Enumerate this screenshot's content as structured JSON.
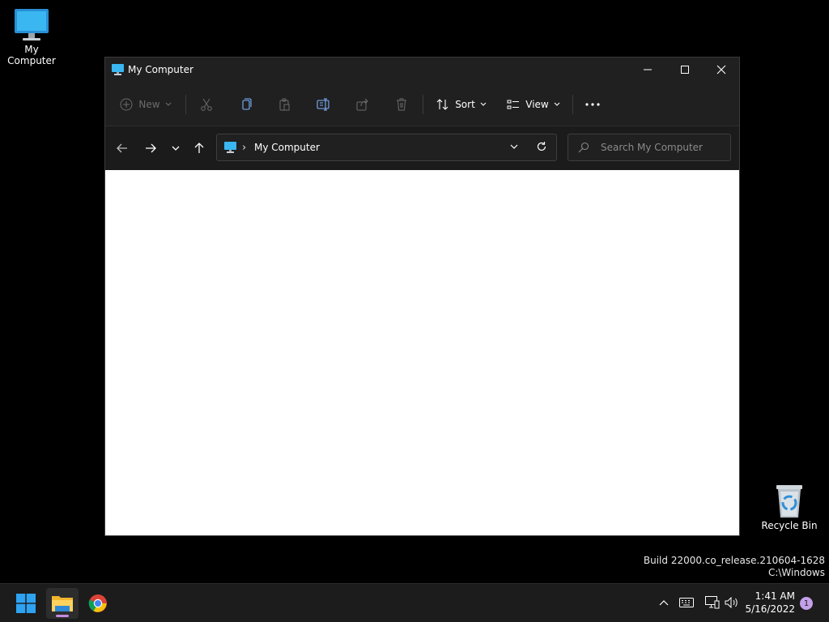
{
  "desktop": {
    "icons": [
      {
        "label": "My Computer",
        "icon": "monitor-icon"
      },
      {
        "label": "Recycle Bin",
        "icon": "recycle-bin-icon"
      }
    ],
    "build_line1": "Build 22000.co_release.210604-1628",
    "build_line2": "C:\\Windows"
  },
  "window": {
    "title": "My Computer",
    "controls": [
      "minimize-icon",
      "maximize-icon",
      "close-icon"
    ],
    "toolbar": {
      "new_label": "New",
      "sort_label": "Sort",
      "view_label": "View",
      "icons": [
        "cut-icon",
        "copy-icon",
        "paste-icon",
        "rename-icon",
        "share-icon",
        "delete-icon",
        "more-icon"
      ]
    },
    "address": {
      "path": "My Computer",
      "separator": "›"
    },
    "search": {
      "placeholder": "Search My Computer"
    }
  },
  "taskbar": {
    "apps": [
      "windows-start-icon",
      "file-explorer-icon",
      "chrome-icon"
    ],
    "clock_time": "1:41 AM",
    "clock_date": "5/16/2022",
    "notification_count": "1"
  },
  "colors": {
    "accent": "#0078d4",
    "window_bg": "#202020",
    "taskbar_bg": "#1c1c1c",
    "notification": "#c4a0e8"
  }
}
